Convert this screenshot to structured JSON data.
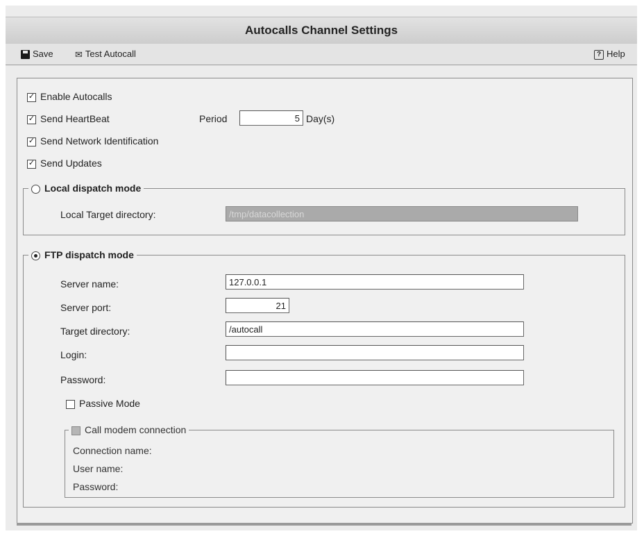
{
  "window": {
    "title": "Autocalls Channel Settings"
  },
  "toolbar": {
    "save_label": "Save",
    "test_label": "Test Autocall",
    "help_label": "Help"
  },
  "options": {
    "enable_autocalls": {
      "label": "Enable Autocalls",
      "checked": true
    },
    "send_heartbeat": {
      "label": "Send HeartBeat",
      "checked": true,
      "period_label": "Period",
      "period_value": "5",
      "period_unit": "Day(s)"
    },
    "send_network_identification": {
      "label": "Send Network Identification",
      "checked": true
    },
    "send_updates": {
      "label": "Send Updates",
      "checked": true
    }
  },
  "local_mode": {
    "label": "Local dispatch mode",
    "selected": false,
    "target_label": "Local Target directory:",
    "target_value": "/tmp/datacollection"
  },
  "ftp_mode": {
    "label": "FTP dispatch mode",
    "selected": true,
    "server_name_label": "Server name:",
    "server_name_value": "127.0.0.1",
    "server_port_label": "Server port:",
    "server_port_value": "21",
    "target_dir_label": "Target directory:",
    "target_dir_value": "/autocall",
    "login_label": "Login:",
    "login_value": "",
    "password_label": "Password:",
    "password_value": "",
    "passive_label": "Passive Mode",
    "passive_checked": false
  },
  "modem": {
    "label": "Call modem connection",
    "checked": false,
    "connection_name_label": "Connection name:",
    "user_name_label": "User name:",
    "password_label": "Password:"
  }
}
